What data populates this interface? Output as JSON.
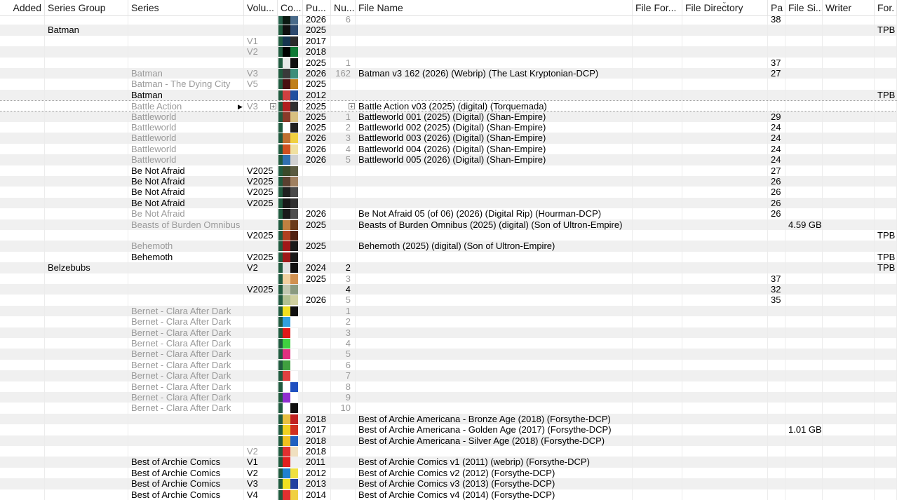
{
  "columns": [
    "Added",
    "Series Group",
    "Series",
    "Volu...",
    "Co...",
    "Pu...",
    "Nu...",
    "File Name",
    "File For...",
    "File Directory",
    "Pa",
    "File Si...",
    "Writer",
    "For."
  ],
  "rows": [
    {
      "group": "",
      "series": "",
      "vol": "",
      "pub": "2026",
      "num": "6",
      "file": "",
      "pages": "38",
      "size": "",
      "format": "",
      "dim": true,
      "cover": [
        "#25604a",
        "#0b1a12",
        "#4a6b8a"
      ]
    },
    {
      "group": "Batman",
      "series": "",
      "vol": "",
      "pub": "2025",
      "num": "",
      "file": "",
      "pages": "",
      "size": "",
      "format": "TPB",
      "dim": false,
      "cover": [
        "#1f5a3e",
        "#101010",
        "#2e4a6e"
      ]
    },
    {
      "group": "",
      "series": "",
      "vol": "V1",
      "pub": "2017",
      "num": "",
      "file": "",
      "pages": "",
      "size": "",
      "format": "",
      "dim": true,
      "cover": [
        "#1f5a3e",
        "#15344f",
        "#2b2b2b"
      ]
    },
    {
      "group": "",
      "series": "",
      "vol": "V2",
      "pub": "2018",
      "num": "",
      "file": "",
      "pages": "",
      "size": "",
      "format": "",
      "dim": true,
      "cover": [
        "#1f5a3e",
        "#000000",
        "#0f7a36"
      ]
    },
    {
      "group": "",
      "series": "",
      "vol": "",
      "pub": "2025",
      "num": "1",
      "file": "",
      "pages": "37",
      "size": "",
      "format": "",
      "dim": true,
      "cover": [
        "#1f5a3e",
        "#e8e8e8",
        "#101010"
      ]
    },
    {
      "group": "",
      "series": "Batman",
      "vol": "V3",
      "pub": "2026",
      "num": "162",
      "file": "Batman v3 162 (2026) (Webrip) (The Last Kryptonian-DCP)",
      "pages": "27",
      "size": "",
      "format": "",
      "dim": true,
      "cover": [
        "#1f5a3e",
        "#3a3a3a",
        "#3d8e7a"
      ]
    },
    {
      "group": "",
      "series": "Batman  - The Dying City",
      "vol": "V5",
      "pub": "2025",
      "num": "",
      "file": "",
      "pages": "",
      "size": "",
      "format": "",
      "dim": true,
      "cover": [
        "#1f5a3e",
        "#4a1010",
        "#c0801a"
      ]
    },
    {
      "group": "",
      "series": "Batman",
      "vol": "",
      "pub": "2012",
      "num": "",
      "file": "",
      "pages": "",
      "size": "",
      "format": "TPB",
      "dim": false,
      "cover": [
        "#1f5a3e",
        "#d04040",
        "#2050a0"
      ]
    },
    {
      "group": "",
      "series": "Battle Action",
      "vol": "V3",
      "pub": "2025",
      "num": "",
      "file": "Battle Action v03 (2025) (digital) (Torquemada)",
      "pages": "",
      "size": "",
      "format": "",
      "dim": true,
      "cover": [
        "#1f5a3e",
        "#b02020",
        "#303030"
      ]
    },
    {
      "group": "",
      "series": "Battleworld",
      "vol": "",
      "pub": "2025",
      "num": "1",
      "file": "Battleworld 001 (2025) (Digital) (Shan-Empire)",
      "pages": "29",
      "size": "",
      "format": "",
      "dim": true,
      "cover": [
        "#1f5a3e",
        "#8a3a2a",
        "#d8c080"
      ]
    },
    {
      "group": "",
      "series": "Battleworld",
      "vol": "",
      "pub": "2025",
      "num": "2",
      "file": "Battleworld 002 (2025) (Digital) (Shan-Empire)",
      "pages": "24",
      "size": "",
      "format": "",
      "dim": true,
      "cover": [
        "#1f5a3e",
        "#ffffff",
        "#202020"
      ]
    },
    {
      "group": "",
      "series": "Battleworld",
      "vol": "",
      "pub": "2026",
      "num": "3",
      "file": "Battleworld 003 (2026) (Digital) (Shan-Empire)",
      "pages": "24",
      "size": "",
      "format": "",
      "dim": true,
      "cover": [
        "#1f5a3e",
        "#c07030",
        "#f0d040"
      ]
    },
    {
      "group": "",
      "series": "Battleworld",
      "vol": "",
      "pub": "2026",
      "num": "4",
      "file": "Battleworld 004 (2026) (Digital) (Shan-Empire)",
      "pages": "24",
      "size": "",
      "format": "",
      "dim": true,
      "cover": [
        "#1f5a3e",
        "#d05020",
        "#f0e0a0"
      ]
    },
    {
      "group": "",
      "series": "Battleworld",
      "vol": "",
      "pub": "2026",
      "num": "5",
      "file": "Battleworld 005 (2026) (Digital) (Shan-Empire)",
      "pages": "24",
      "size": "",
      "format": "",
      "dim": true,
      "cover": [
        "#1f5a3e",
        "#3070b0",
        "#d0d0d0"
      ]
    },
    {
      "group": "",
      "series": "Be Not Afraid",
      "vol": "V2025",
      "pub": "",
      "num": "",
      "file": "",
      "pages": "27",
      "size": "",
      "format": "",
      "dim": false,
      "cover": [
        "#1f5a3e",
        "#3a4a2a",
        "#5a5a40"
      ]
    },
    {
      "group": "",
      "series": "Be Not Afraid",
      "vol": "V2025",
      "pub": "",
      "num": "",
      "file": "",
      "pages": "26",
      "size": "",
      "format": "",
      "dim": false,
      "cover": [
        "#1f5a3e",
        "#5a4030",
        "#a08060"
      ]
    },
    {
      "group": "",
      "series": "Be Not Afraid",
      "vol": "V2025",
      "pub": "",
      "num": "",
      "file": "",
      "pages": "26",
      "size": "",
      "format": "",
      "dim": false,
      "cover": [
        "#1f5a3e",
        "#202020",
        "#4a4a4a"
      ]
    },
    {
      "group": "",
      "series": "Be Not Afraid",
      "vol": "V2025",
      "pub": "",
      "num": "",
      "file": "",
      "pages": "26",
      "size": "",
      "format": "",
      "dim": false,
      "cover": [
        "#1f5a3e",
        "#181818",
        "#303030"
      ]
    },
    {
      "group": "",
      "series": "Be Not Afraid",
      "vol": "",
      "pub": "2026",
      "num": "",
      "file": "Be Not Afraid 05 (of 06) (2026) (Digital Rip) (Hourman-DCP)",
      "pages": "26",
      "size": "",
      "format": "",
      "dim": true,
      "cover": [
        "#1f5a3e",
        "#1a1a1a",
        "#505050"
      ]
    },
    {
      "group": "",
      "series": "Beasts of Burden Omnibus",
      "vol": "",
      "pub": "2025",
      "num": "",
      "file": "Beasts of Burden Omnibus (2025) (digital) (Son of Ultron-Empire)",
      "pages": "",
      "size": "4.59 GB",
      "format": "",
      "dim": true,
      "cover": [
        "#1f5a3e",
        "#c08040",
        "#6a3a1a"
      ]
    },
    {
      "group": "",
      "series": "",
      "vol": "V2025",
      "pub": "",
      "num": "",
      "file": "",
      "pages": "",
      "size": "",
      "format": "TPB",
      "dim": false,
      "cover": [
        "#1f5a3e",
        "#b04020",
        "#502010"
      ]
    },
    {
      "group": "",
      "series": "Behemoth",
      "vol": "",
      "pub": "2025",
      "num": "",
      "file": "Behemoth (2025) (digital) (Son of Ultron-Empire)",
      "pages": "",
      "size": "",
      "format": "",
      "dim": true,
      "cover": [
        "#1f5a3e",
        "#a01818",
        "#1a1a1a"
      ]
    },
    {
      "group": "",
      "series": "Behemoth",
      "vol": "V2025",
      "pub": "",
      "num": "",
      "file": "",
      "pages": "",
      "size": "",
      "format": "TPB",
      "dim": false,
      "cover": [
        "#1f5a3e",
        "#a01818",
        "#1a1a1a"
      ]
    },
    {
      "group": "Belzebubs",
      "series": "",
      "vol": "V2",
      "pub": "2024",
      "num": "2",
      "file": "",
      "pages": "",
      "size": "",
      "format": "TPB",
      "dim": false,
      "cover": [
        "#1f5a3e",
        "#e0e0e0",
        "#101010"
      ]
    },
    {
      "group": "",
      "series": "",
      "vol": "",
      "pub": "2025",
      "num": "3",
      "file": "",
      "pages": "37",
      "size": "",
      "format": "",
      "dim": true,
      "cover": [
        "#1f5a3e",
        "#f0d0a0",
        "#d09050"
      ]
    },
    {
      "group": "",
      "series": "",
      "vol": "V2025",
      "pub": "",
      "num": "4",
      "file": "",
      "pages": "32",
      "size": "",
      "format": "",
      "dim": false,
      "cover": [
        "#1f5a3e",
        "#c0c8b0",
        "#8a9a80"
      ]
    },
    {
      "group": "",
      "series": "",
      "vol": "",
      "pub": "2026",
      "num": "5",
      "file": "",
      "pages": "35",
      "size": "",
      "format": "",
      "dim": true,
      "cover": [
        "#1f5a3e",
        "#b0c090",
        "#d0d0a0"
      ]
    },
    {
      "group": "",
      "series": "Bernet - Clara After Dark",
      "vol": "",
      "pub": "",
      "num": "1",
      "file": "",
      "pages": "",
      "size": "",
      "format": "",
      "dim": true,
      "cover": [
        "#1f5a3e",
        "#f0e020",
        "#101010"
      ]
    },
    {
      "group": "",
      "series": "Bernet - Clara After Dark",
      "vol": "",
      "pub": "",
      "num": "2",
      "file": "",
      "pages": "",
      "size": "",
      "format": "",
      "dim": true,
      "cover": [
        "#1f5a3e",
        "#30a0e0",
        "#ffffff"
      ]
    },
    {
      "group": "",
      "series": "Bernet - Clara After Dark",
      "vol": "",
      "pub": "",
      "num": "3",
      "file": "",
      "pages": "",
      "size": "",
      "format": "",
      "dim": true,
      "cover": [
        "#1f5a3e",
        "#e01818",
        "#ffffff"
      ]
    },
    {
      "group": "",
      "series": "Bernet - Clara After Dark",
      "vol": "",
      "pub": "",
      "num": "4",
      "file": "",
      "pages": "",
      "size": "",
      "format": "",
      "dim": true,
      "cover": [
        "#1f5a3e",
        "#40d040",
        "#ffffff"
      ]
    },
    {
      "group": "",
      "series": "Bernet - Clara After Dark",
      "vol": "",
      "pub": "",
      "num": "5",
      "file": "",
      "pages": "",
      "size": "",
      "format": "",
      "dim": true,
      "cover": [
        "#1f5a3e",
        "#e03080",
        "#ffffff"
      ]
    },
    {
      "group": "",
      "series": "Bernet - Clara After Dark",
      "vol": "",
      "pub": "",
      "num": "6",
      "file": "",
      "pages": "",
      "size": "",
      "format": "",
      "dim": true,
      "cover": [
        "#1f5a3e",
        "#40a040",
        "#ffffff"
      ]
    },
    {
      "group": "",
      "series": "Bernet - Clara After Dark",
      "vol": "",
      "pub": "",
      "num": "7",
      "file": "",
      "pages": "",
      "size": "",
      "format": "",
      "dim": true,
      "cover": [
        "#1f5a3e",
        "#e04040",
        "#ffffff"
      ]
    },
    {
      "group": "",
      "series": "Bernet - Clara After Dark",
      "vol": "",
      "pub": "",
      "num": "8",
      "file": "",
      "pages": "",
      "size": "",
      "format": "",
      "dim": true,
      "cover": [
        "#1f5a3e",
        "#ffffff",
        "#2050c0"
      ]
    },
    {
      "group": "",
      "series": "Bernet - Clara After Dark",
      "vol": "",
      "pub": "",
      "num": "9",
      "file": "",
      "pages": "",
      "size": "",
      "format": "",
      "dim": true,
      "cover": [
        "#1f5a3e",
        "#9030d0",
        "#ffffff"
      ]
    },
    {
      "group": "",
      "series": "Bernet - Clara After Dark",
      "vol": "",
      "pub": "",
      "num": "10",
      "file": "",
      "pages": "",
      "size": "",
      "format": "",
      "dim": true,
      "cover": [
        "#1f5a3e",
        "#ffffff",
        "#101010"
      ]
    },
    {
      "group": "",
      "series": "",
      "vol": "",
      "pub": "2018",
      "num": "",
      "file": "Best of Archie Americana - Bronze Age (2018) (Forsythe-DCP)",
      "pages": "",
      "size": "",
      "format": "",
      "dim": false,
      "cover": [
        "#1f5a3e",
        "#e8c040",
        "#c02020"
      ]
    },
    {
      "group": "",
      "series": "",
      "vol": "",
      "pub": "2017",
      "num": "",
      "file": "Best of Archie Americana - Golden Age (2017) (Forsythe-DCP)",
      "pages": "",
      "size": "1.01 GB",
      "format": "",
      "dim": false,
      "cover": [
        "#1f5a3e",
        "#f0d020",
        "#d03020"
      ]
    },
    {
      "group": "",
      "series": "",
      "vol": "",
      "pub": "2018",
      "num": "",
      "file": "Best of Archie Americana - Silver Age (2018) (Forsythe-DCP)",
      "pages": "",
      "size": "",
      "format": "",
      "dim": false,
      "cover": [
        "#1f5a3e",
        "#f0c020",
        "#2060c0"
      ]
    },
    {
      "group": "",
      "series": "",
      "vol": "V2",
      "pub": "2018",
      "num": "",
      "file": "",
      "pages": "",
      "size": "",
      "format": "",
      "dim": true,
      "cover": [
        "#1f5a3e",
        "#e03030",
        "#f0e0c0"
      ]
    },
    {
      "group": "",
      "series": "Best of Archie Comics",
      "vol": "V1",
      "pub": "2011",
      "num": "",
      "file": "Best of Archie Comics v1 (2011) (webrip) (Forsythe-DCP)",
      "pages": "",
      "size": "",
      "format": "",
      "dim": false,
      "cover": [
        "#1f5a3e",
        "#e02020",
        "#f0f0f0"
      ]
    },
    {
      "group": "",
      "series": "Best of Archie Comics",
      "vol": "V2",
      "pub": "2012",
      "num": "",
      "file": "Best of Archie Comics v2 (2012) (Forsythe-DCP)",
      "pages": "",
      "size": "",
      "format": "",
      "dim": false,
      "cover": [
        "#1f5a3e",
        "#2080d0",
        "#f0e040"
      ]
    },
    {
      "group": "",
      "series": "Best of Archie Comics",
      "vol": "V3",
      "pub": "2013",
      "num": "",
      "file": "Best of Archie Comics v3 (2013) (Forsythe-DCP)",
      "pages": "",
      "size": "",
      "format": "",
      "dim": false,
      "cover": [
        "#1f5a3e",
        "#f0e020",
        "#2040a0"
      ]
    },
    {
      "group": "",
      "series": "Best of Archie Comics",
      "vol": "V4",
      "pub": "2014",
      "num": "",
      "file": "Best of Archie Comics v4 (2014) (Forsythe-DCP)",
      "pages": "",
      "size": "",
      "format": "",
      "dim": false,
      "cover": [
        "#1f5a3e",
        "#e03030",
        "#f0d040"
      ]
    }
  ]
}
